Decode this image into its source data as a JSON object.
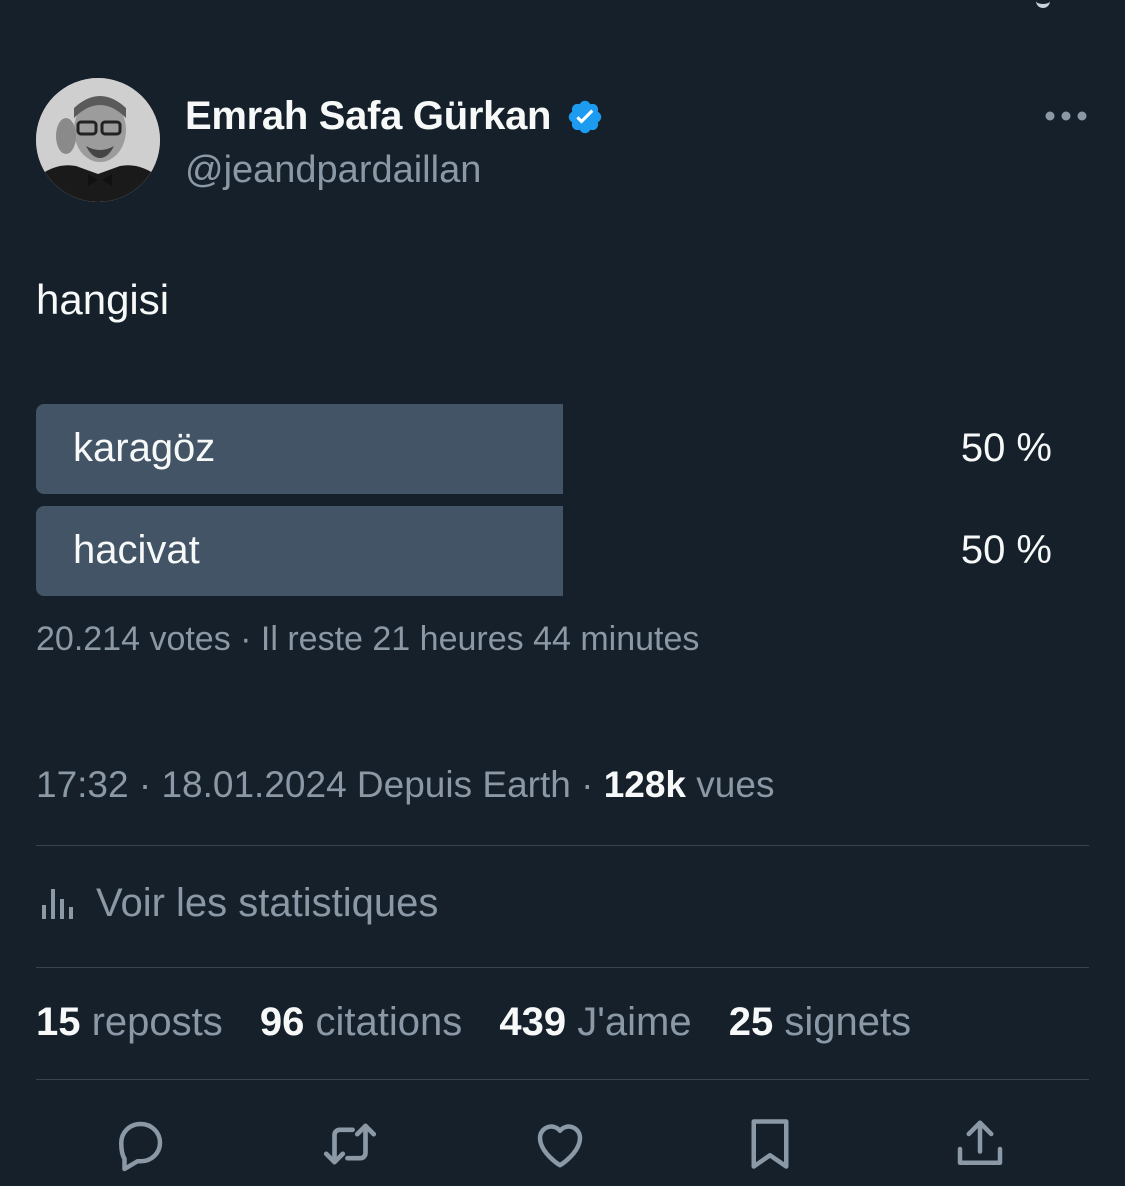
{
  "author": {
    "display_name": "Emrah Safa Gürkan",
    "handle": "@jeandpardaillan",
    "verified": true
  },
  "tweet": {
    "text": "hangisi"
  },
  "poll": {
    "options": [
      {
        "label": "karagöz",
        "percent_text": "50 %",
        "percent": 50
      },
      {
        "label": "hacivat",
        "percent_text": "50 %",
        "percent": 50
      }
    ],
    "meta": "20.214 votes · Il reste 21 heures 44 minutes"
  },
  "timestamp": {
    "time_date": "17:32 · 18.01.2024 Depuis Earth · ",
    "views_count": "128k",
    "views_label": " vues"
  },
  "stats_link": "Voir les statistiques",
  "counts": [
    {
      "num": "15",
      "label": " reposts"
    },
    {
      "num": "96",
      "label": " citations"
    },
    {
      "num": "439",
      "label": " J'aime"
    },
    {
      "num": "25",
      "label": " signets"
    }
  ],
  "actions": [
    "reply-icon",
    "retweet-icon",
    "like-icon",
    "bookmark-icon",
    "share-icon"
  ],
  "colors": {
    "background": "#15202b",
    "text_primary": "#f7f9f9",
    "text_secondary": "#8b98a5",
    "poll_fill": "#425466",
    "verified_blue": "#1d9bf0",
    "divider": "#38444d"
  }
}
